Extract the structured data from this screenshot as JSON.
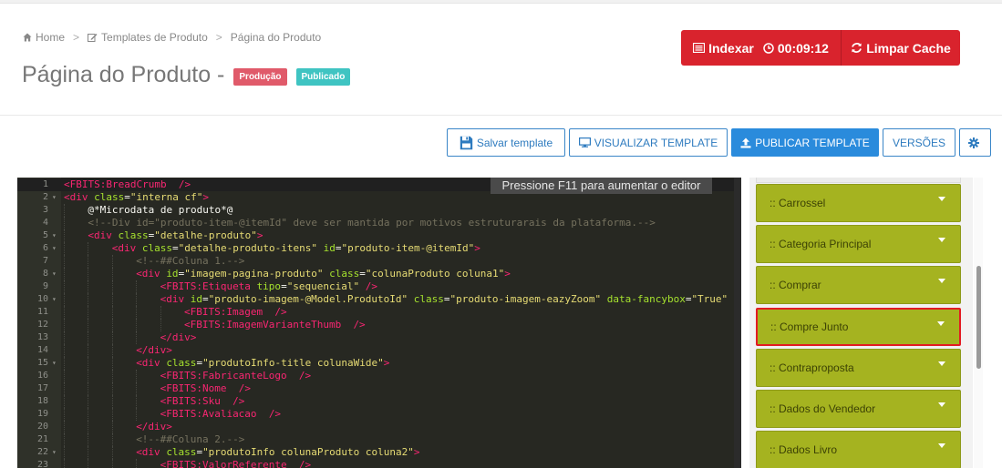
{
  "breadcrumb": {
    "home": "Home",
    "templates": "Templates de Produto",
    "current": "Página do Produto",
    "sep": ">"
  },
  "page": {
    "title": "Página do Produto -",
    "badge_env": "Produção",
    "badge_status": "Publicado"
  },
  "header_actions": {
    "index_label": "Indexar",
    "timer": "00:09:12",
    "clear_cache_label": "Limpar Cache"
  },
  "toolbar": {
    "save": "Salvar template",
    "view": "VISUALIZAR TEMPLATE",
    "publish": "PUBLICAR TEMPLATE",
    "versions": "VERSÕES"
  },
  "editor": {
    "hint": "Pressione F11 para aumentar o editor",
    "active_line": 1,
    "lines": [
      {
        "n": "1",
        "fold": false,
        "indent": 0,
        "tokens": [
          [
            "tag",
            "<FBITS:BreadCrumb"
          ],
          [
            "txt",
            "  "
          ],
          [
            "tag",
            "/>"
          ]
        ]
      },
      {
        "n": "2",
        "fold": true,
        "indent": 0,
        "tokens": [
          [
            "tag",
            "<div"
          ],
          [
            "txt",
            " "
          ],
          [
            "attr",
            "class"
          ],
          [
            "txt",
            "="
          ],
          [
            "str",
            "\"interna cf\""
          ],
          [
            "tag",
            ">"
          ]
        ]
      },
      {
        "n": "3",
        "fold": false,
        "indent": 1,
        "tokens": [
          [
            "txt",
            "@*Microdata de produto*@"
          ]
        ]
      },
      {
        "n": "4",
        "fold": false,
        "indent": 1,
        "tokens": [
          [
            "com",
            "<!--Div id=\"produto-item-@itemId\" deve ser mantida por motivos estruturarais da plataforma.-->"
          ]
        ]
      },
      {
        "n": "5",
        "fold": true,
        "indent": 1,
        "tokens": [
          [
            "tag",
            "<div"
          ],
          [
            "txt",
            " "
          ],
          [
            "attr",
            "class"
          ],
          [
            "txt",
            "="
          ],
          [
            "str",
            "\"detalhe-produto\""
          ],
          [
            "tag",
            ">"
          ]
        ]
      },
      {
        "n": "6",
        "fold": true,
        "indent": 2,
        "tokens": [
          [
            "tag",
            "<div"
          ],
          [
            "txt",
            " "
          ],
          [
            "attr",
            "class"
          ],
          [
            "txt",
            "="
          ],
          [
            "str",
            "\"detalhe-produto-itens\""
          ],
          [
            "txt",
            " "
          ],
          [
            "attr",
            "id"
          ],
          [
            "txt",
            "="
          ],
          [
            "str",
            "\"produto-item-@itemId\""
          ],
          [
            "tag",
            ">"
          ]
        ]
      },
      {
        "n": "7",
        "fold": false,
        "indent": 3,
        "tokens": [
          [
            "com",
            "<!--##Coluna 1.-->"
          ]
        ]
      },
      {
        "n": "8",
        "fold": true,
        "indent": 3,
        "tokens": [
          [
            "tag",
            "<div"
          ],
          [
            "txt",
            " "
          ],
          [
            "attr",
            "id"
          ],
          [
            "txt",
            "="
          ],
          [
            "str",
            "\"imagem-pagina-produto\""
          ],
          [
            "txt",
            " "
          ],
          [
            "attr",
            "class"
          ],
          [
            "txt",
            "="
          ],
          [
            "str",
            "\"colunaProduto coluna1\""
          ],
          [
            "tag",
            ">"
          ]
        ]
      },
      {
        "n": "9",
        "fold": false,
        "indent": 4,
        "tokens": [
          [
            "tag",
            "<FBITS:Etiqueta"
          ],
          [
            "txt",
            " "
          ],
          [
            "attr",
            "tipo"
          ],
          [
            "txt",
            "="
          ],
          [
            "str",
            "\"sequencial\""
          ],
          [
            "txt",
            " "
          ],
          [
            "tag",
            "/>"
          ]
        ]
      },
      {
        "n": "10",
        "fold": true,
        "indent": 4,
        "tokens": [
          [
            "tag",
            "<div"
          ],
          [
            "txt",
            " "
          ],
          [
            "attr",
            "id"
          ],
          [
            "txt",
            "="
          ],
          [
            "str",
            "\"produto-imagem-@Model.ProdutoId\""
          ],
          [
            "txt",
            " "
          ],
          [
            "attr",
            "class"
          ],
          [
            "txt",
            "="
          ],
          [
            "str",
            "\"produto-imagem-eazyZoom\""
          ],
          [
            "txt",
            " "
          ],
          [
            "attr",
            "data-fancybox"
          ],
          [
            "txt",
            "="
          ],
          [
            "str",
            "\"True\""
          ]
        ]
      },
      {
        "n": "11",
        "fold": false,
        "indent": 5,
        "tokens": [
          [
            "tag",
            "<FBITS:Imagem"
          ],
          [
            "txt",
            "  "
          ],
          [
            "tag",
            "/>"
          ]
        ]
      },
      {
        "n": "12",
        "fold": false,
        "indent": 5,
        "tokens": [
          [
            "tag",
            "<FBITS:ImagemVarianteThumb"
          ],
          [
            "txt",
            "  "
          ],
          [
            "tag",
            "/>"
          ]
        ]
      },
      {
        "n": "13",
        "fold": false,
        "indent": 4,
        "tokens": [
          [
            "tag",
            "</div>"
          ]
        ]
      },
      {
        "n": "14",
        "fold": false,
        "indent": 3,
        "tokens": [
          [
            "tag",
            "</div>"
          ]
        ]
      },
      {
        "n": "15",
        "fold": true,
        "indent": 3,
        "tokens": [
          [
            "tag",
            "<div"
          ],
          [
            "txt",
            " "
          ],
          [
            "attr",
            "class"
          ],
          [
            "txt",
            "="
          ],
          [
            "str",
            "\"produtoInfo-title colunaWide\""
          ],
          [
            "tag",
            ">"
          ]
        ]
      },
      {
        "n": "16",
        "fold": false,
        "indent": 4,
        "tokens": [
          [
            "tag",
            "<FBITS:FabricanteLogo"
          ],
          [
            "txt",
            "  "
          ],
          [
            "tag",
            "/>"
          ]
        ]
      },
      {
        "n": "17",
        "fold": false,
        "indent": 4,
        "tokens": [
          [
            "tag",
            "<FBITS:Nome"
          ],
          [
            "txt",
            "  "
          ],
          [
            "tag",
            "/>"
          ]
        ]
      },
      {
        "n": "18",
        "fold": false,
        "indent": 4,
        "tokens": [
          [
            "tag",
            "<FBITS:Sku"
          ],
          [
            "txt",
            "  "
          ],
          [
            "tag",
            "/>"
          ]
        ]
      },
      {
        "n": "19",
        "fold": false,
        "indent": 4,
        "tokens": [
          [
            "tag",
            "<FBITS:Avaliacao"
          ],
          [
            "txt",
            "  "
          ],
          [
            "tag",
            "/>"
          ]
        ]
      },
      {
        "n": "20",
        "fold": false,
        "indent": 3,
        "tokens": [
          [
            "tag",
            "</div>"
          ]
        ]
      },
      {
        "n": "21",
        "fold": false,
        "indent": 3,
        "tokens": [
          [
            "com",
            "<!--##Coluna 2.-->"
          ]
        ]
      },
      {
        "n": "22",
        "fold": true,
        "indent": 3,
        "tokens": [
          [
            "tag",
            "<div"
          ],
          [
            "txt",
            " "
          ],
          [
            "attr",
            "class"
          ],
          [
            "txt",
            "="
          ],
          [
            "str",
            "\"produtoInfo colunaProduto coluna2\""
          ],
          [
            "tag",
            ">"
          ]
        ]
      },
      {
        "n": "23",
        "fold": false,
        "indent": 4,
        "tokens": [
          [
            "tag",
            "<FBITS:ValorReferente"
          ],
          [
            "txt",
            "  "
          ],
          [
            "tag",
            "/>"
          ]
        ]
      }
    ]
  },
  "components": {
    "items": [
      {
        "label": ":: Carrossel",
        "selected": false
      },
      {
        "label": ":: Categoria Principal",
        "selected": false
      },
      {
        "label": ":: Comprar",
        "selected": false
      },
      {
        "label": ":: Compre Junto",
        "selected": true
      },
      {
        "label": ":: Contraproposta",
        "selected": false
      },
      {
        "label": ":: Dados do Vendedor",
        "selected": false
      },
      {
        "label": ":: Dados Livro",
        "selected": false
      }
    ]
  },
  "colors": {
    "accent_red": "#d9232d",
    "primary_blue": "#2a8bdc",
    "component_green": "#a5b320",
    "selection_outline": "#e31b23"
  }
}
